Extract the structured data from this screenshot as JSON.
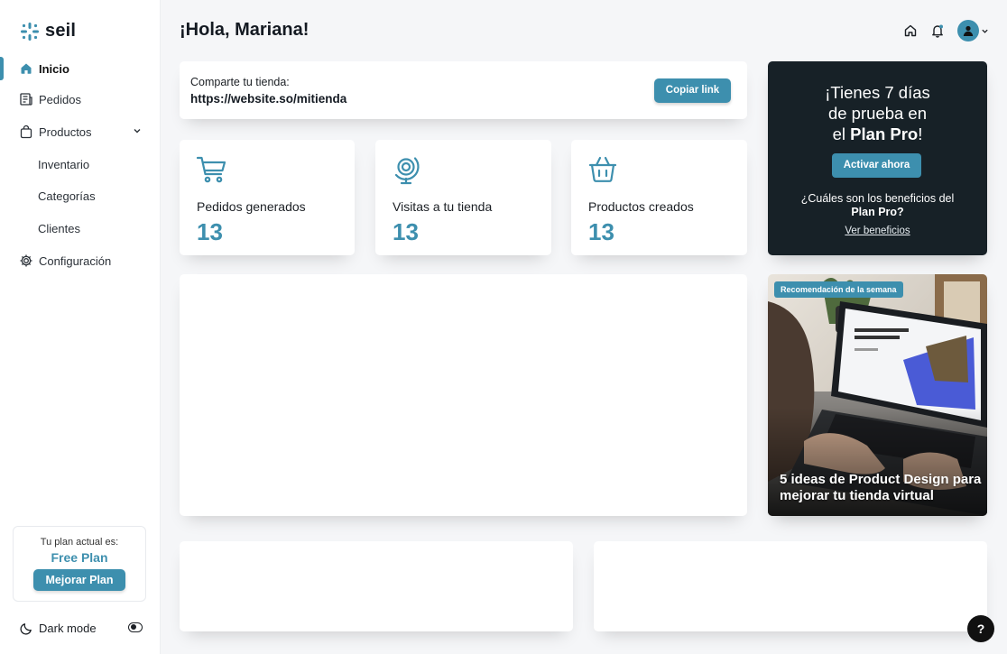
{
  "brand": {
    "name": "seil"
  },
  "sidebar": {
    "items": [
      {
        "label": "Inicio",
        "icon": "home-icon"
      },
      {
        "label": "Pedidos",
        "icon": "receipt-icon"
      },
      {
        "label": "Productos",
        "icon": "bag-icon"
      },
      {
        "label": "Configuración",
        "icon": "gear-icon"
      }
    ],
    "subitems": [
      "Inventario",
      "Categorías",
      "Clientes"
    ]
  },
  "plan": {
    "current_label": "Tu plan actual es:",
    "name": "Free Plan",
    "upgrade_label": "Mejorar Plan"
  },
  "darkmode": {
    "label": "Dark mode"
  },
  "header": {
    "greeting": "¡Hola, Mariana!"
  },
  "share": {
    "label": "Comparte tu tienda:",
    "url": "https://website.so/mitienda",
    "copy_label": "Copiar link"
  },
  "stats": [
    {
      "title": "Pedidos generados",
      "value": "13",
      "icon": "cart-icon"
    },
    {
      "title": "Visitas a tu tienda",
      "value": "13",
      "icon": "globe-icon"
    },
    {
      "title": "Productos creados",
      "value": "13",
      "icon": "basket-icon"
    }
  ],
  "promo": {
    "line1": "¡Tienes 7 días",
    "line2": "de prueba en",
    "line3_prefix": "el ",
    "line3_bold": "Plan Pro",
    "line3_suffix": "!",
    "button": "Activar ahora",
    "question": "¿Cuáles son los beneficios del",
    "question_bold": "Plan Pro?",
    "link": "Ver beneficios"
  },
  "recommendation": {
    "badge": "Recomendación de la semana",
    "title": "5 ideas de Product Design para mejorar tu tienda virtual",
    "screen_text": "Everything you need to start an online store and sell online"
  },
  "help": {
    "label": "?"
  },
  "colors": {
    "accent": "#3d8fae",
    "dark_card": "#172127",
    "background": "#f5f6f8"
  }
}
